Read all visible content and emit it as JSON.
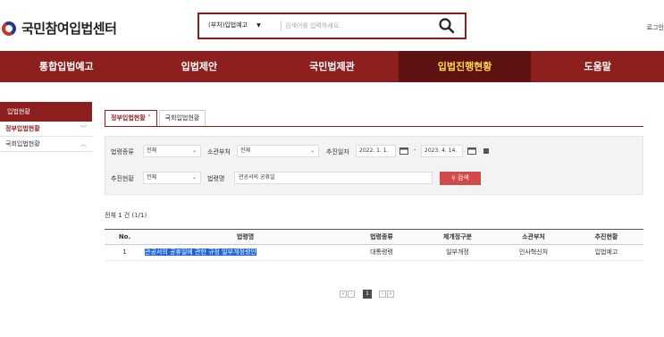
{
  "header": {
    "site_title": "국민참여입법센터",
    "search_scope": "(부처)입법예고",
    "search_placeholder": "검색어를 입력하세요.",
    "login_label": "로그인"
  },
  "nav": {
    "items": [
      "통합입법예고",
      "입법제안",
      "국민법제관",
      "입법진행현황",
      "도움말"
    ],
    "active_index": 3
  },
  "sidebar": {
    "heading": "입법현황",
    "items": [
      {
        "label": "정부입법현황",
        "chevron": "﹀",
        "active": true
      },
      {
        "label": "국회입법현황",
        "chevron": "︿",
        "active": false
      }
    ]
  },
  "tabs": {
    "items": [
      "정부입법현황 ˅",
      "국회입법현황"
    ],
    "active_index": 0
  },
  "filter": {
    "law_type_label": "법령종류",
    "law_type_value": "전체",
    "ministry_label": "소관부처",
    "ministry_value": "전체",
    "date_label": "추진일자",
    "date_from": "2022. 1. 1.",
    "date_to": "2023. 4. 14.",
    "date_sep": "-",
    "status_label": "추진현황",
    "status_value": "전체",
    "law_name_label": "법령명",
    "law_name_value": "관공서의 공휴일",
    "search_button": "검색",
    "search_icon_glyph": "🔍"
  },
  "result": {
    "prefix": "전체 1 건 (",
    "current_page": "1",
    "suffix": "/1)"
  },
  "table": {
    "headers": [
      "No.",
      "법령명",
      "법령종류",
      "제개정구분",
      "소관부처",
      "추진현황"
    ],
    "rows": [
      [
        "1",
        "관공서의 공휴일에 관한 규정 일부개정령안",
        "대통령령",
        "일부개정",
        "인사혁신처",
        "입법예고"
      ]
    ]
  },
  "pager": {
    "first": "«",
    "prev": "‹",
    "page": "1",
    "next": "›",
    "last": "»"
  },
  "colors": {
    "brand": "#8e1f1f",
    "nav_active_bg": "#5e1212",
    "nav_active_text": "#ffd94a",
    "link_highlight": "#1f64d8",
    "search_button": "#d34a4a"
  }
}
